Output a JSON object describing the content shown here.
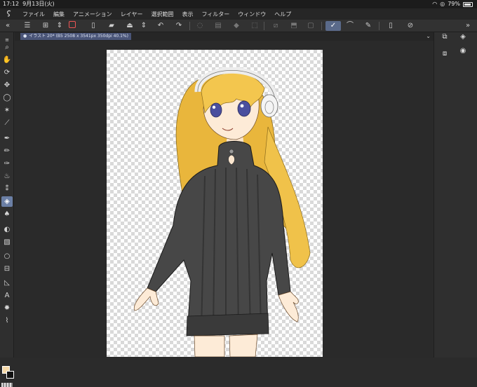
{
  "status_bar": {
    "time": "17:12",
    "date": "9月13日(火)",
    "battery": "79%"
  },
  "menu": {
    "items": [
      "ファイル",
      "編集",
      "アニメーション",
      "レイヤー",
      "選択範囲",
      "表示",
      "フィルター",
      "ウィンドウ",
      "ヘルプ"
    ]
  },
  "canvas_tab": {
    "label": "イラスト 20* (B5 2508 x 3541px 350dpi 40.1%)"
  },
  "colors": {
    "main_color": "#f6d9a8",
    "sub_color": "#111111",
    "active_tool": "#6b7fa5"
  },
  "toolbar": {
    "icons": [
      "menu-icon",
      "new-canvas-icon",
      "chevron-updown-icon",
      "record-icon",
      "new-file-icon",
      "open-folder-icon",
      "save-icon",
      "chevron-updown-icon",
      "undo-icon",
      "redo-icon",
      "loading-icon",
      "clear-icon",
      "fill-icon",
      "transform-icon",
      "hide-selection-icon",
      "crop-icon",
      "deselect-icon",
      "pen-stabilizer-icon",
      "brush-icon",
      "draw-icon",
      "device-icon",
      "settings-icon"
    ]
  },
  "left_tools": [
    "zoom-icon",
    "hand-icon",
    "rotate-icon",
    "move-icon",
    "lasso-icon",
    "magic-wand-icon",
    "eyedropper-icon",
    "pen-icon",
    "pencil-icon",
    "fountain-pen-icon",
    "airbrush-icon",
    "decoration-icon",
    "eraser-icon",
    "blend-icon",
    "fill-icon",
    "gradient-icon",
    "figure-icon",
    "frame-icon",
    "ruler-icon",
    "text-icon",
    "balloon-icon",
    "correction-icon"
  ]
}
